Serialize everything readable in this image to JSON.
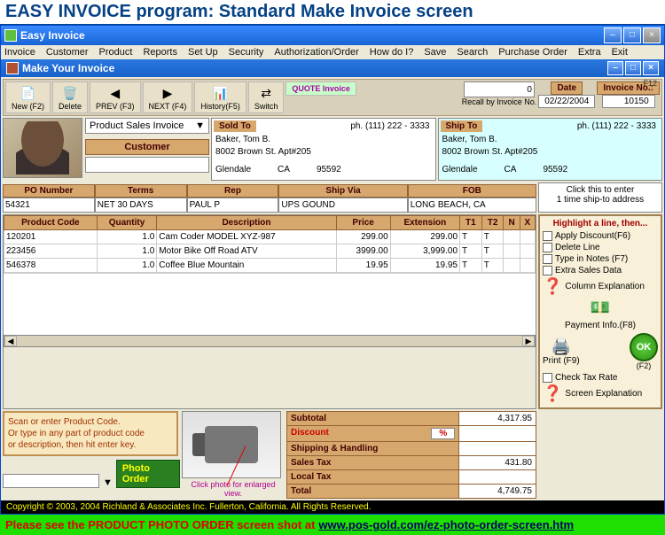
{
  "screen_title": "EASY INVOICE program: Standard  Make Invoice  screen",
  "app_title": "Easy Invoice",
  "sub_title": "Make Your Invoice",
  "menu": [
    "Invoice",
    "Customer",
    "Product",
    "Reports",
    "Set Up",
    "Security",
    "Authorization/Order",
    "How do I?",
    "Save",
    "Search",
    "Purchase Order",
    "Extra",
    "Exit"
  ],
  "toolbar": {
    "new": "New (F2)",
    "delete": "Delete",
    "prev": "PREV (F3)",
    "next": "NEXT (F4)",
    "history": "History(F5)",
    "switch": "Switch",
    "quote": "QUOTE Invoice",
    "recall_label": "Recall by Invoice No.",
    "recall_value": "0",
    "date_label": "Date",
    "date_value": "02/22/2004",
    "invno_label": "Invoice No.:",
    "invno_value": "10150",
    "f12": "F12"
  },
  "invoice_type": "Product Sales Invoice",
  "customer_label": "Customer",
  "sold_to": {
    "title": "Sold To",
    "phone": "ph.  (111) 222 - 3333",
    "name": "Baker, Tom B.",
    "addr": "8002 Brown St. Apt#205",
    "city": "Glendale",
    "state": "CA",
    "zip": "95592"
  },
  "ship_to": {
    "title": "Ship To",
    "phone": "ph.  (111) 222 - 3333",
    "name": "Baker, Tom B.",
    "addr": "8002 Brown St. Apt#205",
    "city": "Glendale",
    "state": "CA",
    "zip": "95592"
  },
  "ship_link": {
    "l1": "Click this to enter",
    "l2": "1 time ship-to address"
  },
  "headers": {
    "po": {
      "h": "PO Number",
      "v": "54321"
    },
    "terms": {
      "h": "Terms",
      "v": "NET 30 DAYS"
    },
    "rep": {
      "h": "Rep",
      "v": "PAUL P"
    },
    "shipvia": {
      "h": "Ship Via",
      "v": "UPS GOUND"
    },
    "fob": {
      "h": "FOB",
      "v": "LONG BEACH, CA"
    }
  },
  "items_cols": [
    "Product Code",
    "Quantity",
    "Description",
    "Price",
    "Extension",
    "T1",
    "T2",
    "N",
    "X"
  ],
  "items": [
    {
      "code": "120201",
      "qty": "1.0",
      "desc": "Cam Coder MODEL XYZ-987",
      "price": "299.00",
      "ext": "299.00",
      "t1": "T",
      "t2": "T"
    },
    {
      "code": "223456",
      "qty": "1.0",
      "desc": "Motor Bike Off Road ATV",
      "price": "3999.00",
      "ext": "3,999.00",
      "t1": "T",
      "t2": "T"
    },
    {
      "code": "546378",
      "qty": "1.0",
      "desc": "Coffee Blue Mountain",
      "price": "19.95",
      "ext": "19.95",
      "t1": "T",
      "t2": "T"
    }
  ],
  "side": {
    "title": "Highlight a line, then...",
    "discount": "Apply Discount(F6)",
    "delete": "Delete Line",
    "notes": "Type in Notes (F7)",
    "extra": "Extra Sales Data",
    "col_expl": "Column Explanation",
    "payinfo": "Payment Info.(F8)",
    "print": "Print (F9)",
    "ok_key": "(F2)",
    "checktax": "Check Tax Rate",
    "screen_expl": "Screen Explanation",
    "ok": "OK"
  },
  "hint": {
    "l1": "Scan or enter Product Code.",
    "l2": "Or type in any part of product code",
    "l3": "or description, then hit enter key."
  },
  "photo_order": "Photo Order",
  "photo_caption": "Click photo for enlarged view.",
  "totals": {
    "subtotal": {
      "l": "Subtotal",
      "v": "4,317.95"
    },
    "discount": {
      "l": "Discount",
      "pct": "%",
      "v": ""
    },
    "ship": {
      "l": "Shipping & Handling",
      "v": ""
    },
    "stax": {
      "l": "Sales Tax",
      "v": "431.80"
    },
    "ltax": {
      "l": "Local Tax",
      "v": ""
    },
    "total": {
      "l": "Total",
      "v": "4,749.75"
    }
  },
  "copyright": "Copyright  ©  2003, 2004   Richland & Associates Inc. Fullerton, California.    All Rights Reserved.",
  "footer": {
    "text": "Please see the  PRODUCT PHOTO ORDER  screen shot at  ",
    "url": "www.pos-gold.com/ez-photo-order-screen.htm"
  }
}
